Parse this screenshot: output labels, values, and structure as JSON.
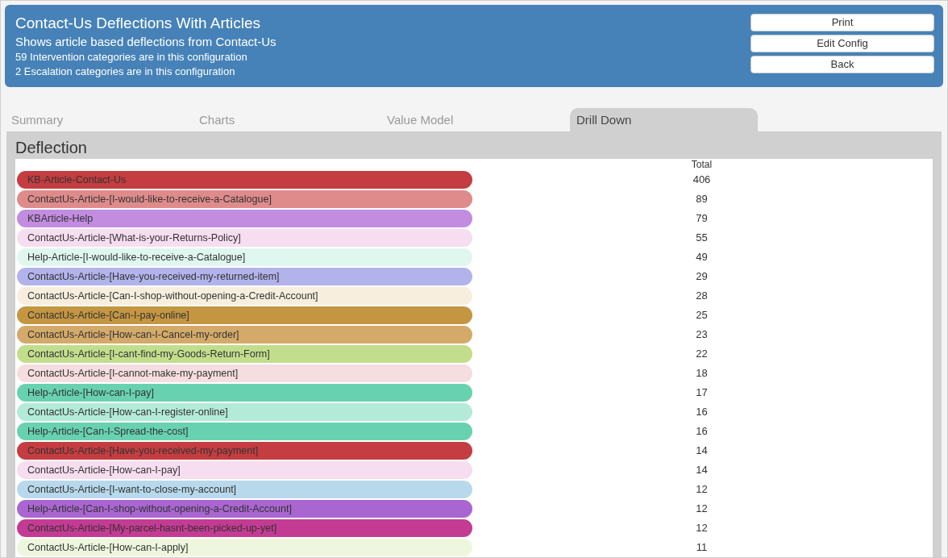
{
  "header": {
    "title": "Contact-Us Deflections With Articles",
    "subtitle": "Shows article based deflections from Contact-Us",
    "lines": [
      "59 Intervention categories are in this configuration",
      "2 Escalation categories are in this configuration"
    ],
    "buttons": [
      "Print",
      "Edit Config",
      "Back"
    ]
  },
  "tabs": [
    {
      "label": "Summary",
      "selected": false
    },
    {
      "label": "Charts",
      "selected": false
    },
    {
      "label": "Value Model",
      "selected": false
    },
    {
      "label": "Drill Down",
      "selected": true
    }
  ],
  "section": {
    "title": "Deflection",
    "column": "Total",
    "rows": [
      {
        "label": "KB-Article-Contact-Us",
        "total": "406",
        "color": "#c43d40"
      },
      {
        "label": "ContactUs-Article-[I-would-like-to-receive-a-Catalogue]",
        "total": "89",
        "color": "#df8b8b"
      },
      {
        "label": "KBArticle-Help",
        "total": "79",
        "color": "#c28ce0"
      },
      {
        "label": "ContactUs-Article-[What-is-your-Returns-Policy]",
        "total": "55",
        "color": "#f6ddf0"
      },
      {
        "label": "Help-Article-[I-would-like-to-receive-a-Catalogue]",
        "total": "49",
        "color": "#dff7ef"
      },
      {
        "label": "ContactUs-Article-[Have-you-received-my-returned-item]",
        "total": "29",
        "color": "#b3b3ec"
      },
      {
        "label": "ContactUs-Article-[Can-I-shop-without-opening-a-Credit-Account]",
        "total": "28",
        "color": "#f7eedd"
      },
      {
        "label": "ContactUs-Article-[Can-I-pay-online]",
        "total": "25",
        "color": "#c49642"
      },
      {
        "label": "ContactUs-Article-[How-can-I-Cancel-my-order]",
        "total": "23",
        "color": "#d4aa6a"
      },
      {
        "label": "ContactUs-Article-[I-cant-find-my-Goods-Return-Form]",
        "total": "22",
        "color": "#c2de8d"
      },
      {
        "label": "ContactUs-Article-[I-cannot-make-my-payment]",
        "total": "18",
        "color": "#f6dde0"
      },
      {
        "label": "Help-Article-[How-can-I-pay]",
        "total": "17",
        "color": "#68d2b0"
      },
      {
        "label": "ContactUs-Article-[How-can-I-register-online]",
        "total": "16",
        "color": "#b3ead8"
      },
      {
        "label": "Help-Article-[Can-I-Spread-the-cost]",
        "total": "16",
        "color": "#68d2b0"
      },
      {
        "label": "ContactUs-Article-[Have-you-received-my-payment]",
        "total": "14",
        "color": "#c43d40"
      },
      {
        "label": "ContactUs-Article-[How-can-I-pay]",
        "total": "14",
        "color": "#f6ddf0"
      },
      {
        "label": "ContactUs-Article-[I-want-to-close-my-account]",
        "total": "12",
        "color": "#b8d9ec"
      },
      {
        "label": "Help-Article-[Can-I-shop-without-opening-a-Credit-Account]",
        "total": "12",
        "color": "#a966d0"
      },
      {
        "label": "ContactUs-Article-[My-parcel-hasnt-been-picked-up-yet]",
        "total": "12",
        "color": "#c43b93"
      },
      {
        "label": "ContactUs-Article-[How-can-I-apply]",
        "total": "11",
        "color": "#eef7dd"
      }
    ]
  }
}
